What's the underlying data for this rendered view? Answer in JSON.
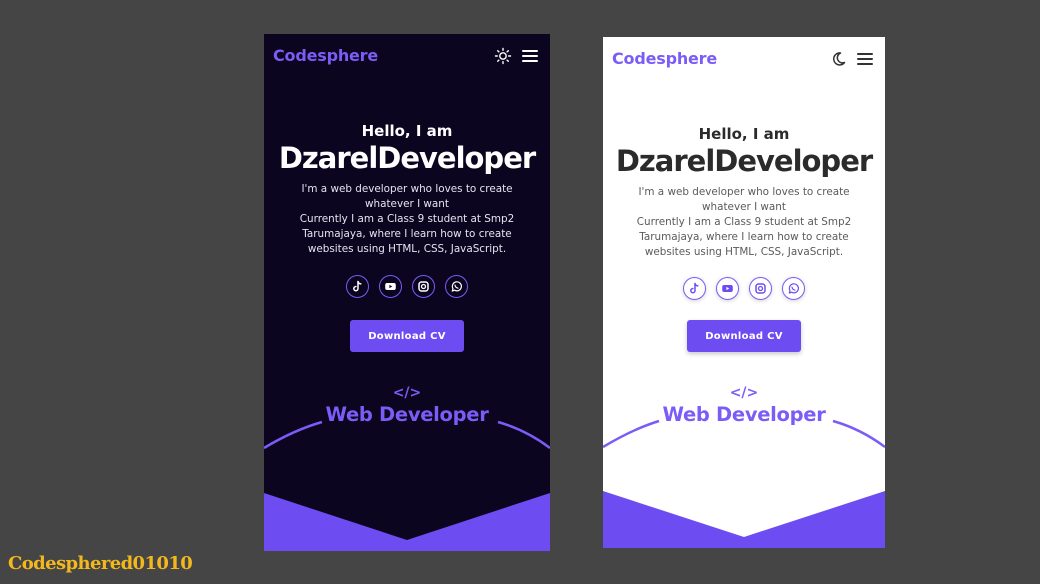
{
  "colors": {
    "accent": "#6d4df2",
    "dark_bg": "#0b0520",
    "light_bg": "#ffffff",
    "stage_bg": "#454545",
    "watermark": "#f3b81d"
  },
  "screens": [
    {
      "theme": "dark",
      "logo": "Codesphere",
      "theme_toggle_icon": "sun-icon",
      "menu_icon": "hamburger-menu-icon",
      "greeting": "Hello, I am",
      "name": "DzarelDeveloper",
      "description_line1": "I'm a web developer who loves to create whatever I want",
      "description_line2": "Currently I am a Class 9 student at Smp2 Tarumajaya, where I learn how to create websites using HTML, CSS, JavaScript.",
      "social_icons": [
        "tiktok-icon",
        "youtube-icon",
        "instagram-icon",
        "whatsapp-icon"
      ],
      "cta_label": "Download CV",
      "role_icon": "</>",
      "role_title": "Web Developer"
    },
    {
      "theme": "light",
      "logo": "Codesphere",
      "theme_toggle_icon": "moon-icon",
      "menu_icon": "hamburger-menu-icon",
      "greeting": "Hello, I am",
      "name": "DzarelDeveloper",
      "description_line1": "I'm a web developer who loves to create whatever I want",
      "description_line2": "Currently I am a Class 9 student at Smp2 Tarumajaya, where I learn how to create websites using HTML, CSS, JavaScript.",
      "social_icons": [
        "tiktok-icon",
        "youtube-icon",
        "instagram-icon",
        "whatsapp-icon"
      ],
      "cta_label": "Download CV",
      "role_icon": "</>",
      "role_title": "Web Developer"
    }
  ],
  "watermark": "Codesphered01010"
}
